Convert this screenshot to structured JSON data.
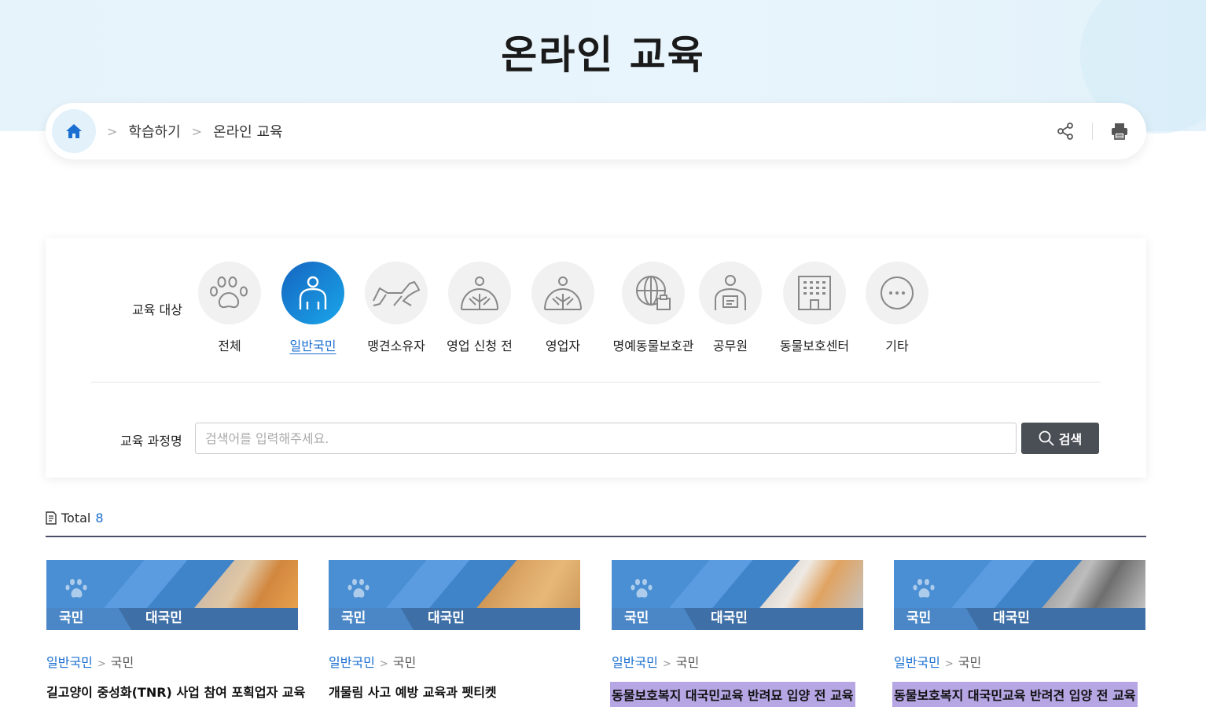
{
  "page": {
    "title": "온라인 교육"
  },
  "breadcrumb": {
    "items": [
      "학습하기",
      "온라인 교육"
    ]
  },
  "filter": {
    "target_label": "교육 대상",
    "categories": [
      {
        "label": "전체",
        "icon": "paw-icon"
      },
      {
        "label": "일반국민",
        "icon": "person-icon",
        "active": true
      },
      {
        "label": "맹견소유자",
        "icon": "dog-icon"
      },
      {
        "label": "영업 신청 전",
        "icon": "person-hands-icon"
      },
      {
        "label": "영업자",
        "icon": "person-hands-icon"
      },
      {
        "label": "명예동물보호관",
        "icon": "globe-badge-icon"
      },
      {
        "label": "공무원",
        "icon": "id-badge-person-icon"
      },
      {
        "label": "동물보호센터",
        "icon": "building-icon"
      },
      {
        "label": "기타",
        "icon": "more-icon"
      }
    ],
    "course_label": "교육 과정명",
    "search_placeholder": "검색어를 입력해주세요.",
    "search_button": "검색"
  },
  "results": {
    "total_label": "Total",
    "total_count": "8"
  },
  "cards": [
    {
      "badge_left": "국민",
      "badge_right": "대국민",
      "cat1": "일반국민",
      "sep": ">",
      "cat2": "국민",
      "title": "길고양이 중성화(TNR) 사업 참여 포획업자 교육"
    },
    {
      "badge_left": "국민",
      "badge_right": "대국민",
      "cat1": "일반국민",
      "sep": ">",
      "cat2": "국민",
      "title": "개물림 사고 예방 교육과 펫티켓"
    },
    {
      "badge_left": "국민",
      "badge_right": "대국민",
      "cat1": "일반국민",
      "sep": ">",
      "cat2": "국민",
      "title": "동물보호복지 대국민교육 반려묘 입양 전 교육"
    },
    {
      "badge_left": "국민",
      "badge_right": "대국민",
      "cat1": "일반국민",
      "sep": ">",
      "cat2": "국민",
      "title": "동물보호복지 대국민교육 반려견 입양 전 교육"
    }
  ]
}
